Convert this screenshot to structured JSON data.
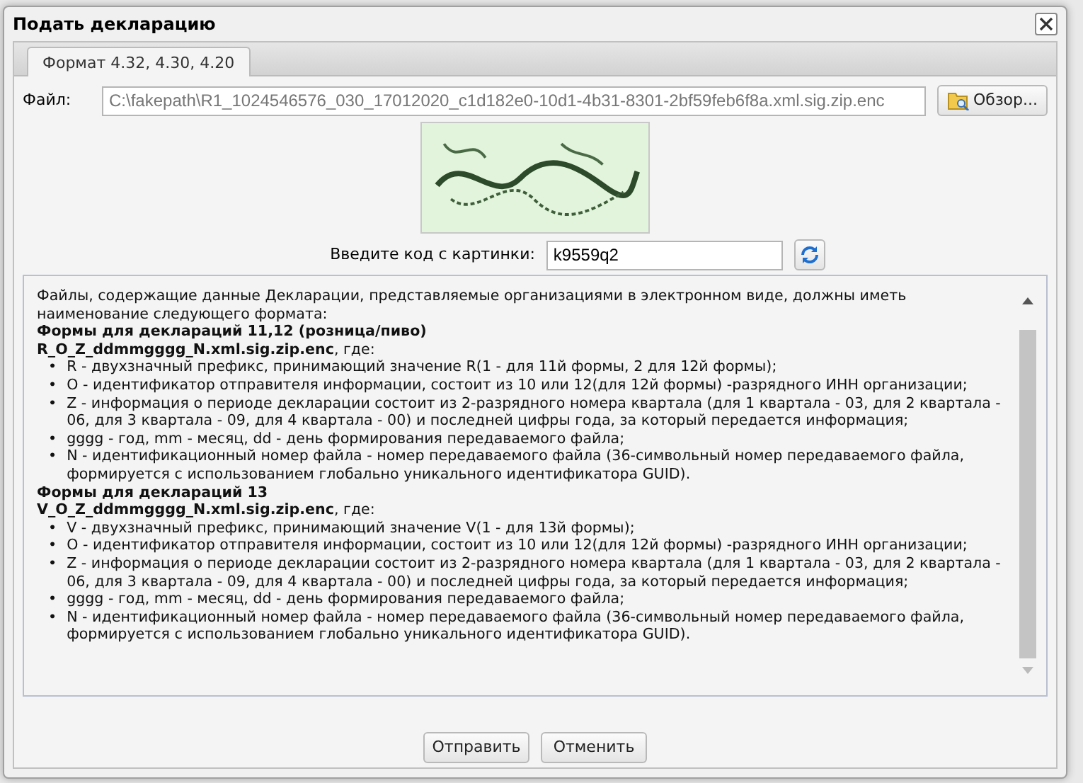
{
  "window": {
    "title": "Подать декларацию"
  },
  "tabs": [
    {
      "label": "Формат 4.32, 4.30, 4.20",
      "selected": true
    }
  ],
  "file": {
    "label": "Файл:",
    "value": "C:\\fakepath\\R1_1024546576_030_17012020_c1d182e0-10d1-4b31-8301-2bf59feb6f8a.xml.sig.zip.enc",
    "browse_button": "Обзор..."
  },
  "captcha": {
    "label": "Введите код с картинки:",
    "value": "k9559q2"
  },
  "description": {
    "intro": "Файлы, содержащие данные Декларации, представляемые организациями в электронном виде, должны иметь наименование следующего формата:",
    "sections": [
      {
        "heading": "Формы для деклараций 11,12 (розница/пиво)",
        "pattern": "**R_O_Z_ddmmgggg_N.xml.sig.zip.enc**, где:",
        "items": [
          {
            "marker": "•",
            "text": "R - двухзначный префикс, принимающий значение R(1 - для 11й формы, 2 для 12й формы);"
          },
          {
            "marker": "•",
            "text": "O - идентификатор отправителя информации, состоит из 10 или 12(для 12й формы) -разрядного ИНН организации;"
          },
          {
            "marker": "•",
            "text": "Z - информация о периоде декларации состоит из 2-разрядного номера квартала (для 1 квартала - 03, для 2 квартала - 06, для 3 квартала - 09, для 4 квартала - 00) и последней цифры года, за который передается информация;"
          },
          {
            "marker": "•",
            "text": "gggg - год, mm - месяц, dd - день формирования передаваемого файла;"
          },
          {
            "marker": "•",
            "text": "N - идентификационный номер файла - номер передаваемого файла (36-символьный номер передаваемого файла, формируется с использованием глобально уникального идентификатора GUID)."
          }
        ]
      },
      {
        "heading": "Формы для деклараций 13",
        "pattern": "**V_O_Z_ddmmgggg_N.xml.sig.zip.enc**, где:",
        "items": [
          {
            "marker": "•",
            "text": "V - двухзначный префикс, принимающий значение V(1 - для 13й формы);"
          },
          {
            "marker": "•",
            "text": "O - идентификатор отправителя информации, состоит из 10 или 12(для 12й формы) -разрядного ИНН организации;"
          },
          {
            "marker": "•",
            "text": "Z - информация о периоде декларации состоит из 2-разрядного номера квартала (для 1 квартала - 03, для 2 квартала - 06, для 3 квартала - 09, для 4 квартала - 00) и последней цифры года, за который передается информация;"
          },
          {
            "marker": "•",
            "text": "gggg - год, mm - месяц, dd - день формирования передаваемого файла;"
          },
          {
            "marker": "•",
            "text": "N - идентификационный номер файла - номер передаваемого файла (36-символьный номер передаваемого файла, формируется с использованием глобально уникального идентификатора GUID)."
          }
        ]
      }
    ]
  },
  "buttons": [
    "Отправить",
    "Отменить"
  ]
}
